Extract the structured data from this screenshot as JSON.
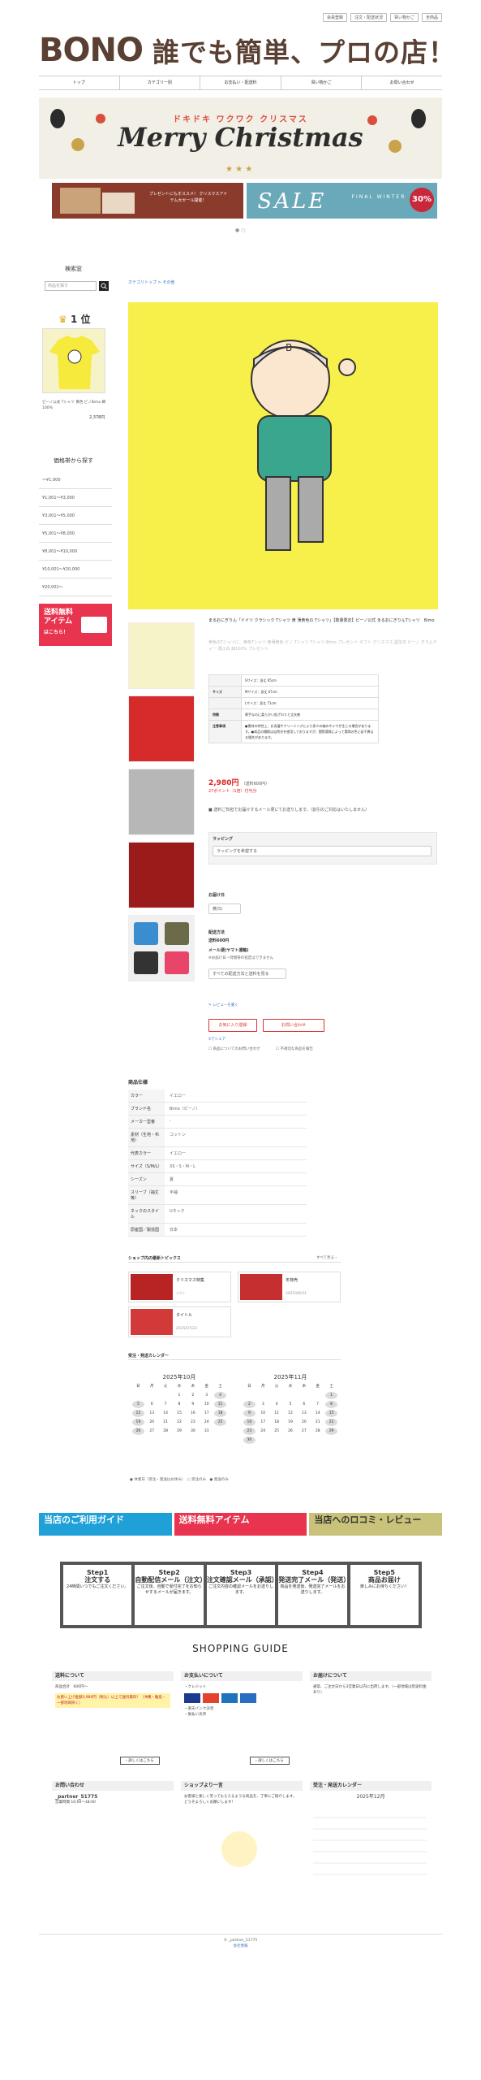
{
  "header": {
    "top_links": [
      "会員登録",
      "注文・配送状況",
      "買い物かご",
      "全商品"
    ],
    "logo": "BONO",
    "tagline": "誰でも簡単、プロの店！",
    "nav": [
      "トップ",
      "カテゴリー別",
      "お支払い・配送料",
      "買い物かご",
      "お問い合わせ"
    ]
  },
  "banner": {
    "subtitle": "ドキドキ ワクワク クリスマス",
    "title": "Merry Christmas",
    "gift_text": "プレゼントにもオススメ！\nクリスマスアイテム大セール開催！",
    "sale_text": "SALE",
    "sale_sub": "FINAL WINTER",
    "percent": "30%"
  },
  "sidebar": {
    "search_heading": "検索窓",
    "search_placeholder": "商品を探す",
    "rank_label": "1 位",
    "rank_item_name": "ピーノ公式 Tシャツ 黄色 ビノBimo 綿100%",
    "rank_item_price": "2,378円",
    "price_heading": "価格帯から探す",
    "price_ranges": [
      "〜¥1,000",
      "¥1,001〜¥3,000",
      "¥3,001〜¥5,000",
      "¥5,001〜¥8,000",
      "¥8,001〜¥10,000",
      "¥10,001〜¥20,000",
      "¥20,001〜"
    ],
    "free_ship": "送料無料 アイテム",
    "free_ship_sub": "はこちら！"
  },
  "product": {
    "breadcrumb": "カテゴリトップ > その他",
    "title": "まるおにぎりん「ドイツ クラシック Tシャツ 黄 薄黄色の Tシャツ」【数量限定】ピーノ公式 まるおにぎりんTシャツ　Bimo",
    "desc": "黄色のTシャツに、黄色Tシャツ 黄薄黄色 ピノ Tシャツ Tシャツ Bimo プレゼント ギフト クリスマス 誕生日 ピーノ ぎりんティー 選ぶ白 綿100% プレゼント",
    "spec_rows": [
      {
        "k": "",
        "v": "Sサイズ：身丈 65cm"
      },
      {
        "k": "サイズ",
        "v": "Mサイズ：身丈 67cm"
      },
      {
        "k": "",
        "v": "Lサイズ：身丈 71cm"
      },
      {
        "k": "特徴",
        "v": "厚手なのに柔らかい肌ざわりと丈夫感"
      },
      {
        "k": "注意事項",
        "v": "●素材の特性上、お洗濯やクリーニングにより多少の縮みやシワが生じる場合があります。●商品の撮影は自然光を使用しておりますが、閲覧環境によって実際の色と若干異なる場合があります。"
      }
    ],
    "price": "2,980円",
    "price_tax": "（送料600円）",
    "points": "27ポイント（1倍）付与分",
    "note": "■ 送料ご負担でお届けするメール便にてお送りします。（割引のご対応はいたしません）",
    "wrapping_label": "ラッピング",
    "wrapping_select": "ラッピングを希望する",
    "size_label": "お届け日",
    "size_select": "黄(S)",
    "delivery_label": "配送方法",
    "delivery_fee": "送料600円",
    "mail_label": "メール便(ヤマト運輸)",
    "mail_desc": "※お届け日・時間帯の指定はできません",
    "method_select": "すべての配送方法と送料を見る",
    "review": "レビューを書く",
    "btn_inquiry": "お気に入り登録",
    "btn_contact": "お問い合わせ",
    "link_share": "Xでシェア",
    "check1": "商品についてのお問い合わせ",
    "check2": "不適切な商品を報告"
  },
  "spec2": {
    "heading": "商品仕様",
    "rows": [
      {
        "k": "カラー",
        "v": "イエロー"
      },
      {
        "k": "ブランド名",
        "v": "Bimo（ビーノ）"
      },
      {
        "k": "メーカー型番",
        "v": "-"
      },
      {
        "k": "素材（生地・布地）",
        "v": "コットン"
      },
      {
        "k": "代表カラー",
        "v": "イエロー"
      },
      {
        "k": "サイズ（S/M/L）",
        "v": "XS・S・M・L"
      },
      {
        "k": "シーズン",
        "v": "夏"
      },
      {
        "k": "スリーブ（袖丈等）",
        "v": "半袖"
      },
      {
        "k": "ネックのスタイル",
        "v": "Uネック"
      },
      {
        "k": "原産国／製造国",
        "v": "日本"
      }
    ]
  },
  "topics": {
    "heading": "ショップ内の最新トピックス",
    "more": "すべて見る ›",
    "items": [
      {
        "title": "クリスマス特集",
        "date": "-/-/-/-"
      },
      {
        "title": "冬特売",
        "date": "2025/08/31"
      },
      {
        "title": "タイトル",
        "date": "2025/07/23"
      }
    ]
  },
  "calendar": {
    "heading": "受注・発送カレンダー",
    "months": [
      {
        "name": "2025年10月",
        "days": [
          "",
          "",
          "",
          "1",
          "2",
          "3",
          "4",
          "5",
          "6",
          "7",
          "8",
          "9",
          "10",
          "11",
          "12",
          "13",
          "14",
          "15",
          "16",
          "17",
          "18",
          "19",
          "20",
          "21",
          "22",
          "23",
          "24",
          "25",
          "26",
          "27",
          "28",
          "29",
          "30",
          "31",
          ""
        ]
      },
      {
        "name": "2025年11月",
        "days": [
          "",
          "",
          "",
          "",
          "",
          "",
          "1",
          "2",
          "3",
          "4",
          "5",
          "6",
          "7",
          "8",
          "9",
          "10",
          "11",
          "12",
          "13",
          "14",
          "15",
          "16",
          "17",
          "18",
          "19",
          "20",
          "21",
          "22",
          "23",
          "24",
          "25",
          "26",
          "27",
          "28",
          "29",
          "30"
        ]
      }
    ],
    "weekdays": [
      "日",
      "月",
      "火",
      "水",
      "木",
      "金",
      "土"
    ],
    "legend": [
      "● 休業日（受注・発送はお休み）",
      "○ 受注のみ",
      "● 発送のみ"
    ]
  },
  "promo": {
    "guide": "当店のご利用ガイド",
    "free": "送料無料アイテム",
    "review": "当店へのロコミ・レビュー"
  },
  "steps": [
    {
      "n": "Step1",
      "t": "注文する",
      "d": "24時間いつでもご注文ください。"
    },
    {
      "n": "Step2",
      "t": "自動配信メール（注文）",
      "d": "ご注文後、自動で受付完了をお知らせするメールが届きます。"
    },
    {
      "n": "Step3",
      "t": "注文確認メール（承認）",
      "d": "ご注文内容の確認メールをお送りします。"
    },
    {
      "n": "Step4",
      "t": "発送完了メール（発送）",
      "d": "商品を発送後、発送完了メールをお送りします。"
    },
    {
      "n": "Step5",
      "t": "商品お届け",
      "d": "楽しみにお待ちください！"
    }
  ],
  "guide": {
    "title": "SHOPPING GUIDE",
    "shipping_head": "送料について",
    "shipping_body": "商品合計　600円〜",
    "shipping_note": "お買い上げ金額3,980円（税込）以上で送料無料！（沖縄・離島・一部地域除く）",
    "payment_head": "お支払いについて",
    "payment_body": "・クレジット",
    "payment_note": "・楽天バンク決済\n・後払い決済",
    "delivery_head": "お届けについて",
    "delivery_body": "通常、ご注文日から3営業日以内に出荷します。（一部地域は別途料金あり）",
    "more": "› 詳しくはこちら",
    "contact_head": "お問い合わせ",
    "contact_name": "_partner_51775",
    "contact_hours": "営業時間 10:00〜18:00",
    "shop_head": "ショップより一言",
    "shop_body": "お客様と楽しく笑ってもらえるような商品を、丁寧にご紹介します。どうぞよろしくお願いします！",
    "cal_head": "受注・発送カレンダー",
    "cal_month": "2025年12月"
  },
  "footer": {
    "copy": "© _partner_51775",
    "link": "会社情報"
  }
}
